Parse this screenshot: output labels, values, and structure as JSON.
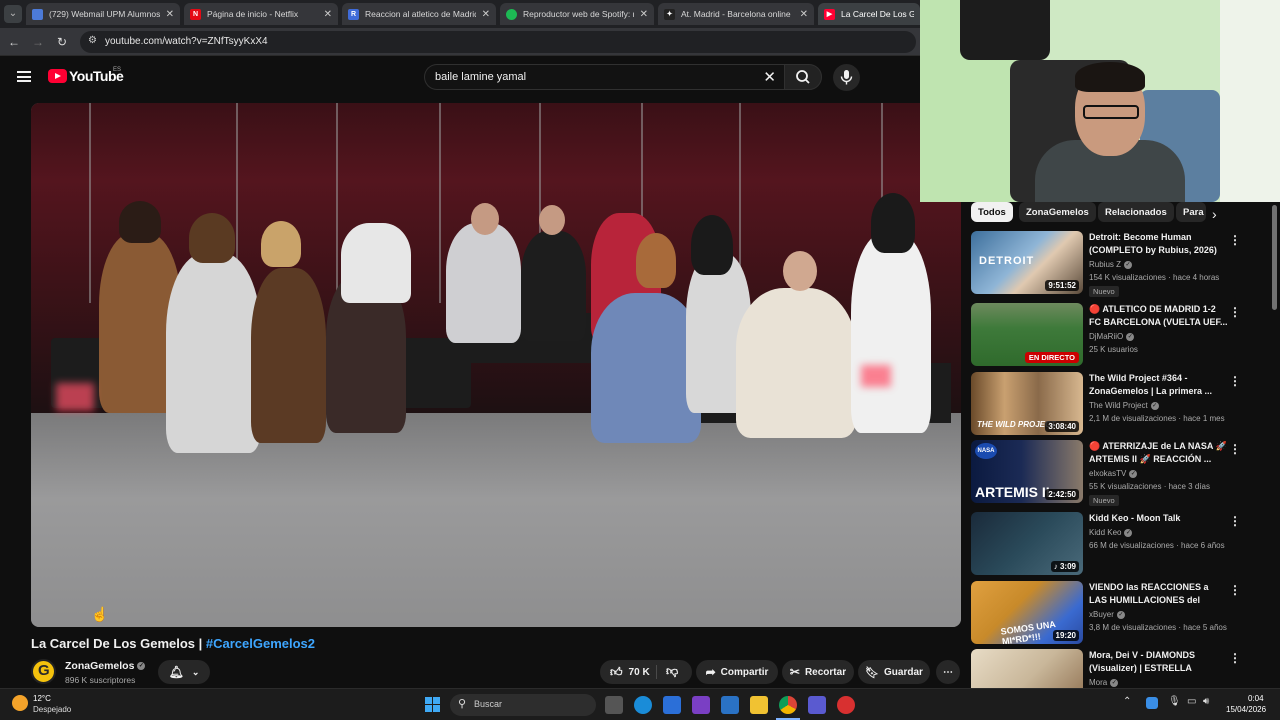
{
  "browser": {
    "tabs": [
      {
        "title": "(729) Webmail UPM Alumnos",
        "favicon_color": "#4c7bd9"
      },
      {
        "title": "Página de inicio - Netflix",
        "favicon_color": "#e50914"
      },
      {
        "title": "Reaccion al atletico de Madrid",
        "favicon_color": "#3f6bd8"
      },
      {
        "title": "Reproductor web de Spotify: m",
        "favicon_color": "#1db954"
      },
      {
        "title": "At. Madrid - Barcelona online",
        "favicon_color": "#222222"
      },
      {
        "title": "La Carcel De Los Gemelos",
        "favicon_color": "#ff0033"
      }
    ],
    "url": "youtube.com/watch?v=ZNfTsyyKxX4"
  },
  "youtube": {
    "logo_text": "YouTube",
    "country_code": "ES",
    "search": {
      "value": "baile lamine yamal"
    }
  },
  "video": {
    "title": "La Carcel De Los Gemelos | ",
    "hashtag": "#CarcelGemelos2",
    "channel": {
      "name": "ZonaGemelos",
      "subscribers": "896 K suscriptores"
    },
    "actions": {
      "likes": "70 K",
      "share": "Compartir",
      "clip": "Recortar",
      "save": "Guardar"
    }
  },
  "sidebar": {
    "chips": [
      "Todos",
      "ZonaGemelos",
      "Relacionados",
      "Para"
    ],
    "items": [
      {
        "title": "Detroit: Become Human (COMPLETO by Rubius, 2026)",
        "channel": "Rubius Z",
        "meta": "154 K visualizaciones · hace 4 horas",
        "badge": "Nuevo",
        "duration": "9:51:52",
        "thumb_color": "#3d6f9c"
      },
      {
        "title": "🔴 ATLETICO DE MADRID 1-2 FC BARCELONA (VUELTA UEF...",
        "channel": "DjMaRiiO",
        "meta": "25 K usuarios",
        "badge": "",
        "duration": "EN DIRECTO",
        "thumb_color": "#3e7a3a"
      },
      {
        "title": "The Wild Project #364 - ZonaGemelos | La primera ...",
        "channel": "The Wild Project",
        "meta": "2,1 M de visualizaciones · hace 1 mes",
        "badge": "",
        "duration": "3:08:40",
        "thumb_color": "#6a4a2a"
      },
      {
        "title": "🔴 ATERRIZAJE de LA NASA 🚀 ARTEMIS II 🚀 REACCIÓN ...",
        "channel": "elxokasTV",
        "meta": "55 K visualizaciones · hace 3 días",
        "badge": "Nuevo",
        "duration": "2:42:50",
        "thumb_color": "#1b2a55"
      },
      {
        "title": "Kidd Keo - Moon Talk",
        "channel": "Kidd Keo",
        "meta": "66 M de visualizaciones · hace 6 años",
        "badge": "",
        "duration": "3:09",
        "thumb_color": "#2a4a5a"
      },
      {
        "title": "VIENDO las REACCIONES a LAS HUMILLACIONES del BARÇA ...",
        "channel": "xBuyer",
        "meta": "3,8 M de visualizaciones · hace 5 años",
        "badge": "",
        "duration": "19:20",
        "thumb_color": "#c88a2a"
      },
      {
        "title": "Mora, Dei V - DIAMONDS (Visualizer) | ESTRELLA",
        "channel": "Mora",
        "meta": "",
        "badge": "",
        "duration": "",
        "thumb_color": "#d9c9b0"
      }
    ]
  },
  "taskbar": {
    "weather_temp": "12°C",
    "weather_desc": "Despejado",
    "search_placeholder": "Buscar",
    "time": "0:04",
    "date": "15/04/2026"
  }
}
